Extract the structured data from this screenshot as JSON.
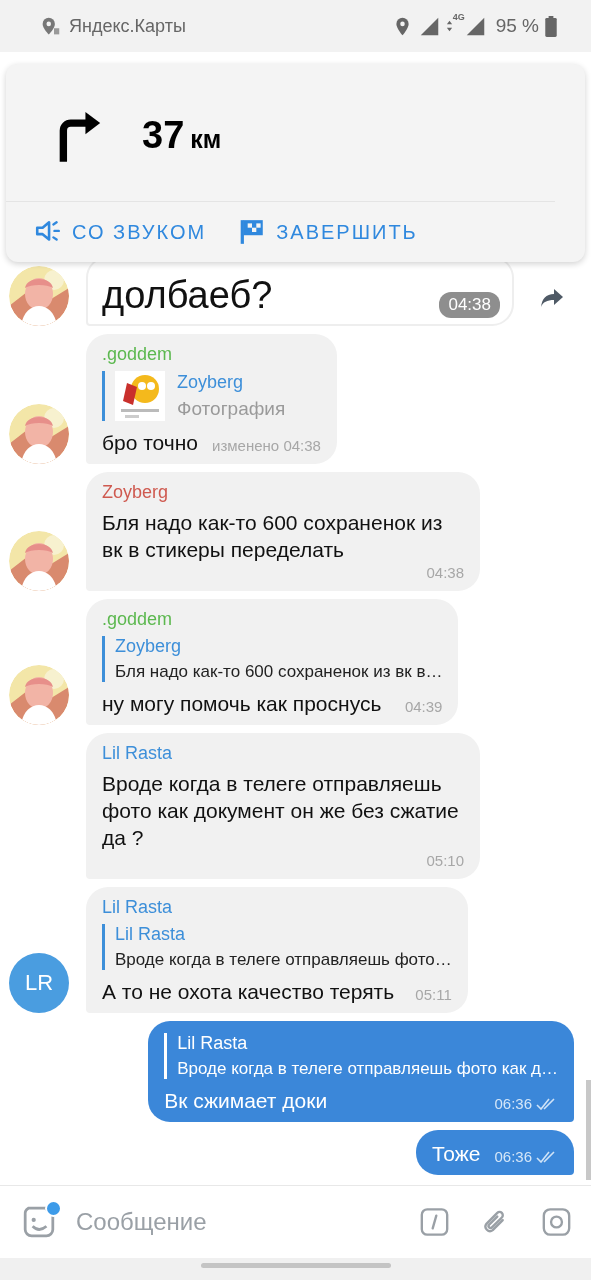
{
  "status_bar": {
    "app": "Яндекс.Карты",
    "network": "4G",
    "battery": "95 %"
  },
  "navigation": {
    "distance": "37",
    "unit": "км",
    "actions": [
      {
        "kind": "sound",
        "label": "СО ЗВУКОМ"
      },
      {
        "kind": "finish",
        "label": "ЗАВЕРШИТЬ"
      }
    ]
  },
  "messages": [
    {
      "outgoing": false,
      "kind": "big",
      "text": "долбаеб?",
      "time": "04:38",
      "share": true
    },
    {
      "outgoing": false,
      "kind": "text",
      "sender": {
        "name": ".goddem",
        "color": "#5cb84f"
      },
      "reply": {
        "name": "Zoyberg",
        "text": "Фотография",
        "thumbnail": true
      },
      "text": "бро точно",
      "time": "изменено 04:38"
    },
    {
      "outgoing": false,
      "kind": "text",
      "sender": {
        "name": "Zoyberg",
        "color": "#cf5a50"
      },
      "text": "Бля надо как-то 600 сохраненок из вк в стикеры переделать",
      "time": "04:38"
    },
    {
      "outgoing": false,
      "kind": "text",
      "sender": {
        "name": ".goddem",
        "color": "#5cb84f"
      },
      "reply": {
        "name": "Zoyberg",
        "text": "Бля надо как-то 600 сохраненок из вк в…"
      },
      "text": "ну могу помочь как проснусь",
      "time": "04:39"
    },
    {
      "outgoing": false,
      "kind": "text",
      "sender": {
        "name": "Lil Rasta",
        "color": "#3d8fd9"
      },
      "text": "Вроде когда в телеге отправляешь фото как документ он же без сжатие да ?",
      "time": "05:10"
    },
    {
      "outgoing": false,
      "kind": "text",
      "avatar": {
        "kind": "initials",
        "text": "LR"
      },
      "sender": {
        "name": "Lil Rasta",
        "color": "#3d8fd9"
      },
      "reply": {
        "name": "Lil Rasta",
        "text": "Вроде когда в телеге отправляешь фото…"
      },
      "text": "А то не охота качество терять",
      "time": "05:11"
    },
    {
      "outgoing": true,
      "kind": "text",
      "reply": {
        "name": "Lil Rasta",
        "text": "Вроде когда в телеге отправляешь фото как д…"
      },
      "text": "Вк сжимает доки",
      "time": "06:36",
      "read": true
    },
    {
      "outgoing": true,
      "kind": "text",
      "text": "Тоже",
      "time": "06:36",
      "read": true
    }
  ],
  "composer": {
    "placeholder": "Сообщение",
    "sticker_badge": true
  }
}
